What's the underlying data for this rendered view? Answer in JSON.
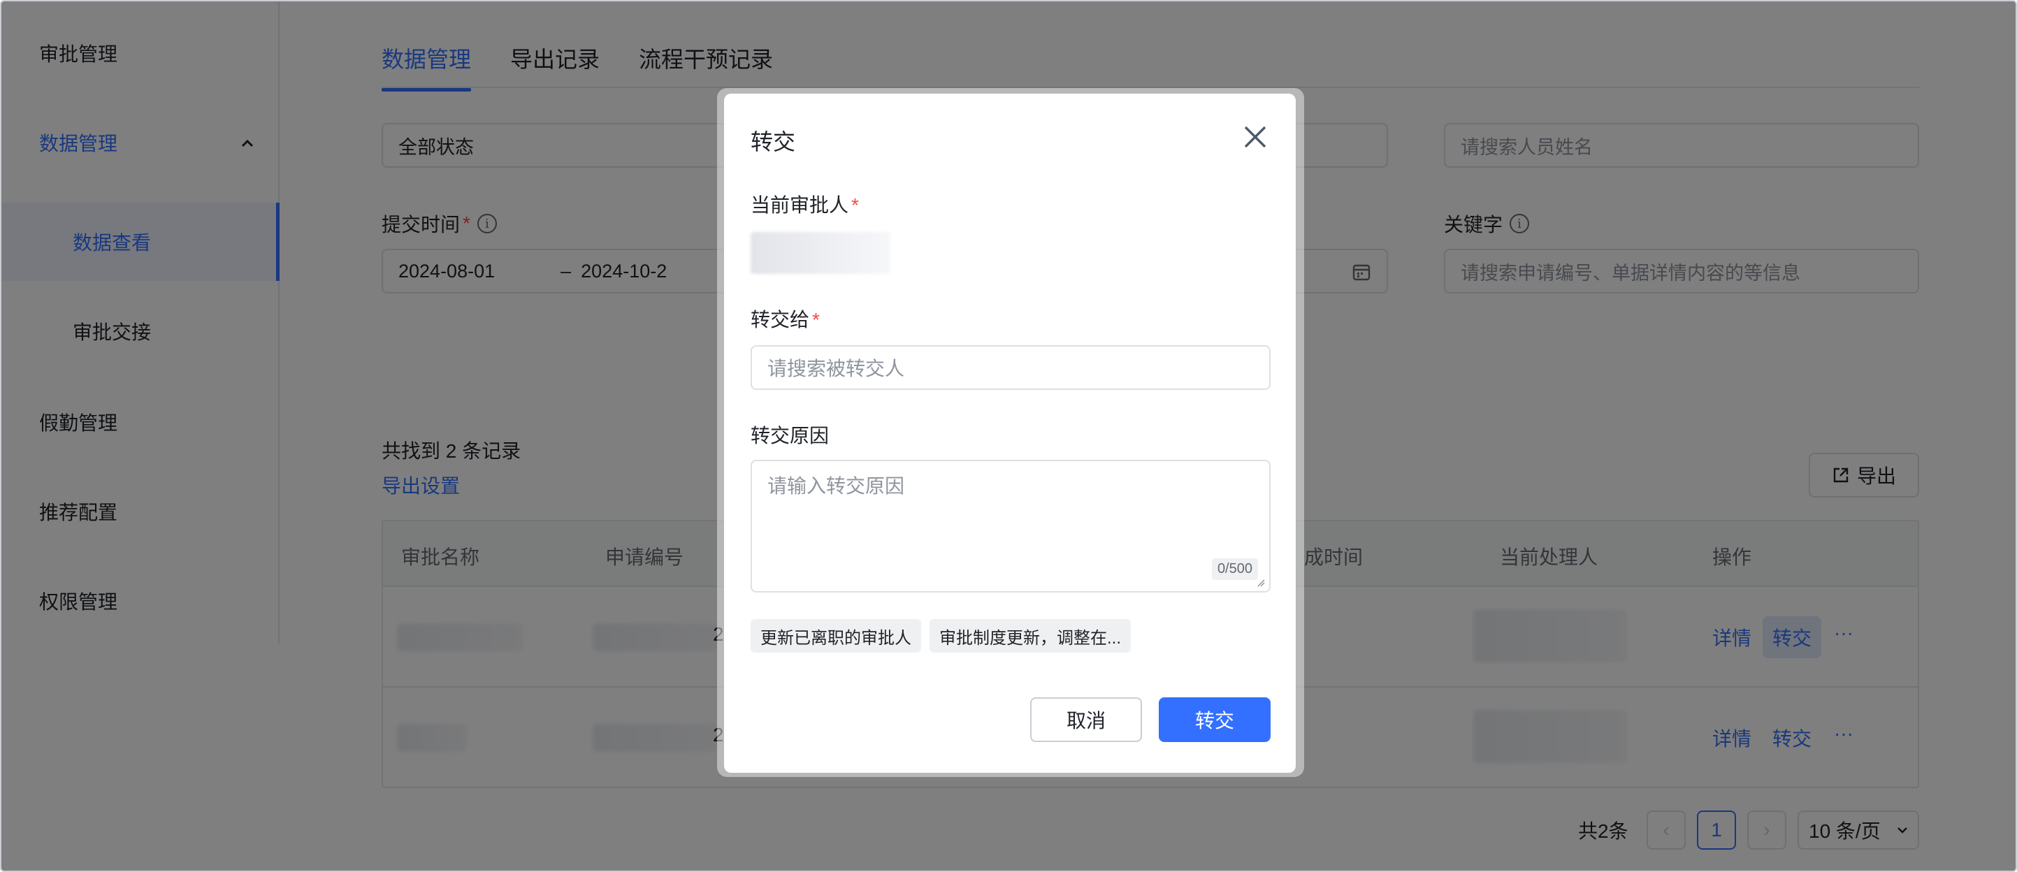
{
  "sidebar": {
    "items": [
      {
        "label": "审批管理"
      },
      {
        "label": "数据管理"
      },
      {
        "label": "数据查看"
      },
      {
        "label": "审批交接"
      },
      {
        "label": "假勤管理"
      },
      {
        "label": "推荐配置"
      },
      {
        "label": "权限管理"
      }
    ]
  },
  "tabs": [
    {
      "label": "数据管理"
    },
    {
      "label": "导出记录"
    },
    {
      "label": "流程干预记录"
    }
  ],
  "filters": {
    "status_value": "全部状态",
    "person_placeholder": "请搜索人员姓名",
    "submit_time_label": "提交时间",
    "date_start": "2024-08-01",
    "date_sep": "–",
    "date_end": "2024-10-2",
    "keyword_label": "关键字",
    "keyword_placeholder": "请搜索申请编号、单据详情内容的等信息"
  },
  "results": {
    "count_text": "共找到 2 条记录",
    "export_settings": "导出设置",
    "export_button": "导出"
  },
  "table": {
    "headers": [
      "审批名称",
      "申请编号",
      "成时间",
      "当前处理人",
      "操作"
    ],
    "row_ops": [
      {
        "detail": "详情",
        "transfer": "转交",
        "more": "···"
      },
      {
        "detail": "详情",
        "transfer": "转交",
        "more": "···"
      }
    ],
    "row_partial": [
      "2",
      "2"
    ]
  },
  "pagination": {
    "total": "共2条",
    "prev": "‹",
    "current": "1",
    "next": "›",
    "page_size": "10 条/页"
  },
  "dialog": {
    "title": "转交",
    "current_approver_label": "当前审批人",
    "transfer_to_label": "转交给",
    "transfer_to_placeholder": "请搜索被转交人",
    "reason_label": "转交原因",
    "reason_placeholder": "请输入转交原因",
    "reason_counter": "0/500",
    "quick_reasons": [
      "更新已离职的审批人",
      "审批制度更新，调整在..."
    ],
    "cancel": "取消",
    "confirm": "转交"
  },
  "colors": {
    "accent": "#3370ff",
    "required": "#f54a45",
    "overlay": "rgba(0,0,0,0.5)"
  }
}
